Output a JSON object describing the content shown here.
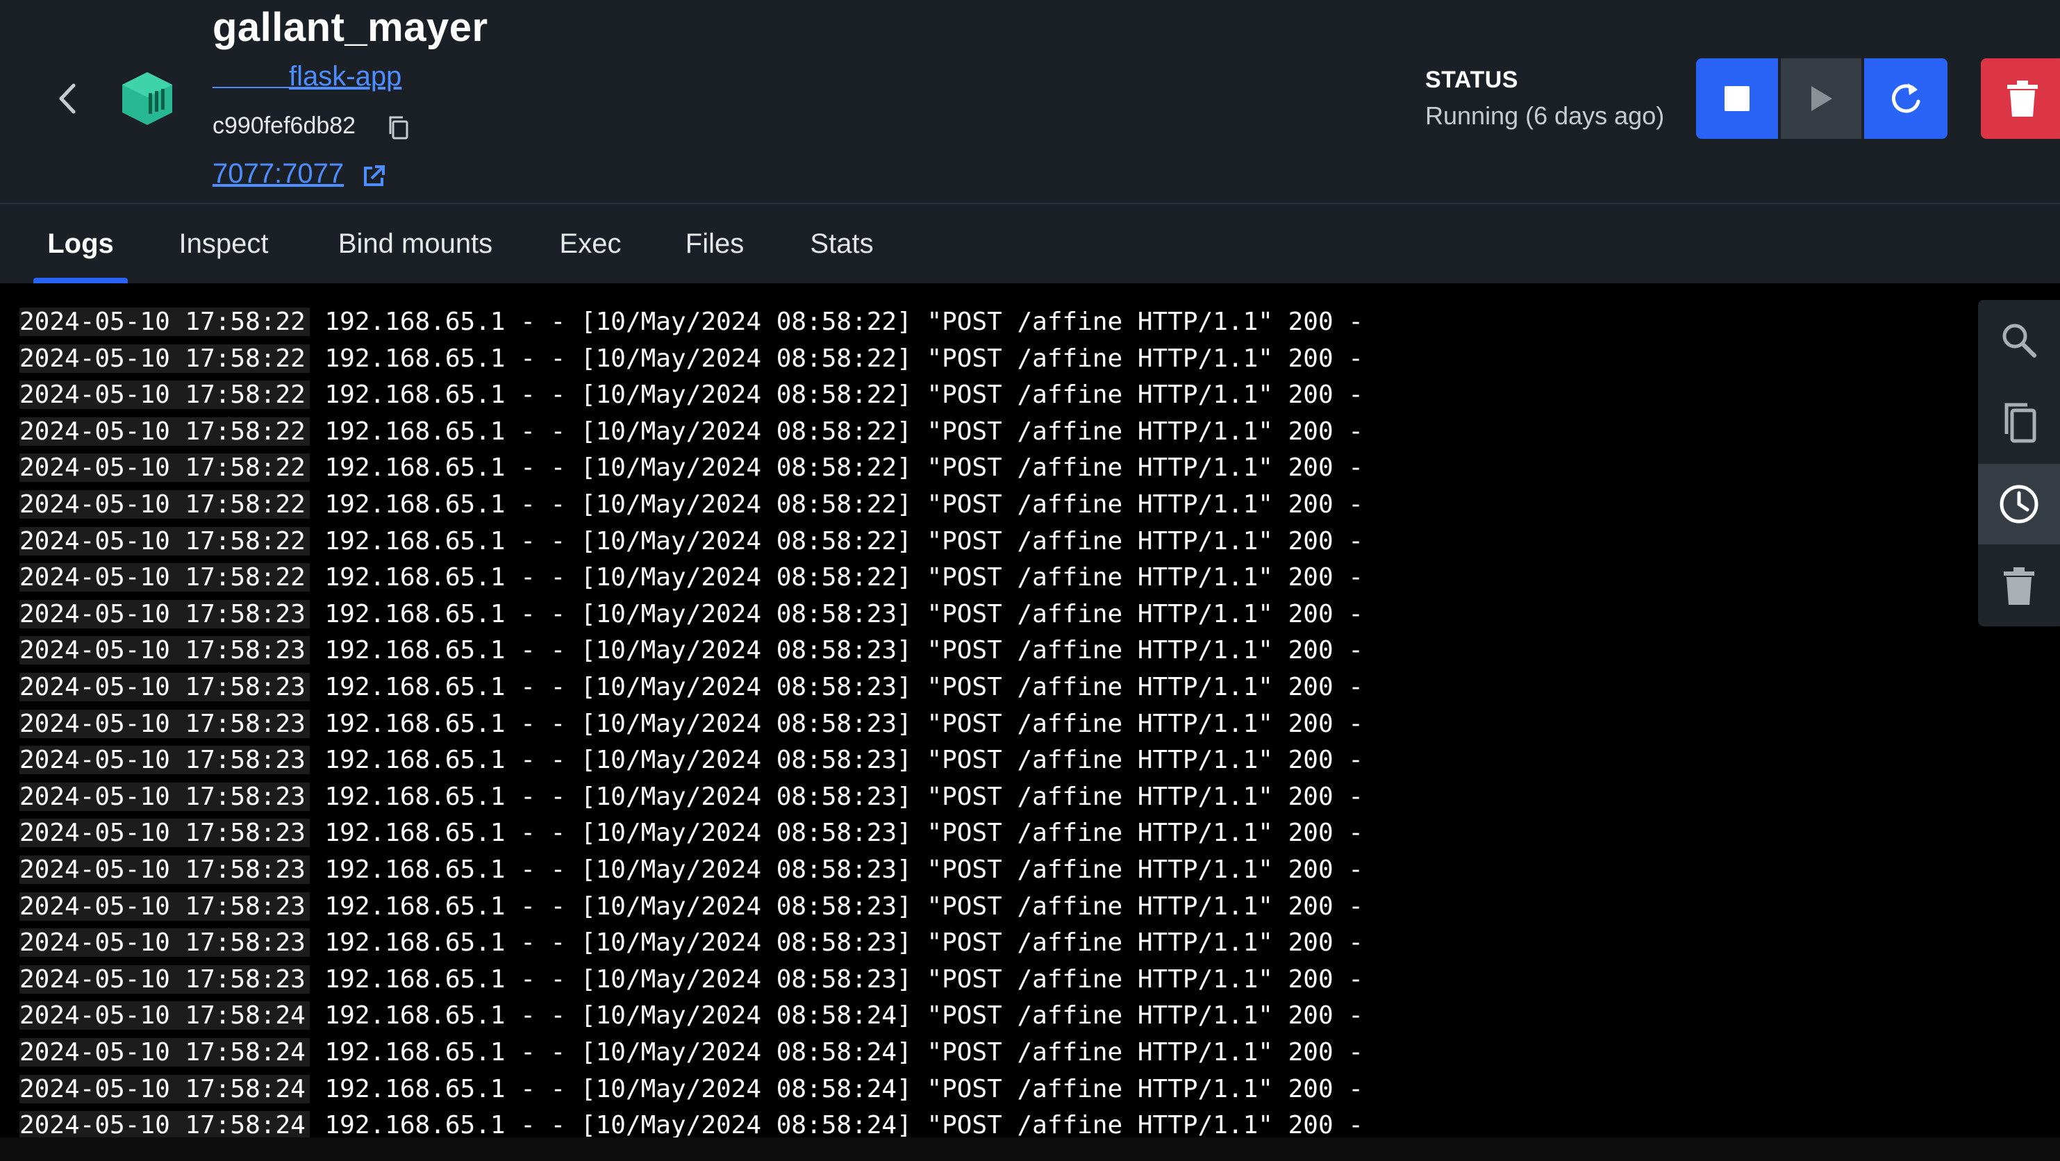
{
  "header": {
    "container_name": "gallant_mayer",
    "image_link": "flask-app",
    "container_id": "c990fef6db82",
    "port_link": "7077:7077",
    "status_label": "STATUS",
    "status_value": "Running (6 days ago)"
  },
  "colors": {
    "accent": "#2a64f6",
    "link": "#4c8dff",
    "danger": "#dc3545",
    "container_logo": "#26b991"
  },
  "icons": {
    "back": "chevron-left-icon",
    "logo": "container-icon",
    "copy": "copy-icon",
    "external": "external-link-icon",
    "stop": "stop-icon",
    "start": "play-icon",
    "restart": "restart-icon",
    "delete": "trash-icon",
    "search": "search-icon",
    "copy_logs": "copy-icon",
    "timestamps": "clock-icon",
    "clear": "trash-icon"
  },
  "tabs": [
    {
      "label": "Logs",
      "active": true
    },
    {
      "label": "Inspect"
    },
    {
      "label": "Bind mounts"
    },
    {
      "label": "Exec"
    },
    {
      "label": "Files"
    },
    {
      "label": "Stats"
    }
  ],
  "logs": [
    {
      "ts": "2024-05-10 17:58:22",
      "msg": " 192.168.65.1 - - [10/May/2024 08:58:22] \"POST /affine HTTP/1.1\" 200 -"
    },
    {
      "ts": "2024-05-10 17:58:22",
      "msg": " 192.168.65.1 - - [10/May/2024 08:58:22] \"POST /affine HTTP/1.1\" 200 -"
    },
    {
      "ts": "2024-05-10 17:58:22",
      "msg": " 192.168.65.1 - - [10/May/2024 08:58:22] \"POST /affine HTTP/1.1\" 200 -"
    },
    {
      "ts": "2024-05-10 17:58:22",
      "msg": " 192.168.65.1 - - [10/May/2024 08:58:22] \"POST /affine HTTP/1.1\" 200 -"
    },
    {
      "ts": "2024-05-10 17:58:22",
      "msg": " 192.168.65.1 - - [10/May/2024 08:58:22] \"POST /affine HTTP/1.1\" 200 -"
    },
    {
      "ts": "2024-05-10 17:58:22",
      "msg": " 192.168.65.1 - - [10/May/2024 08:58:22] \"POST /affine HTTP/1.1\" 200 -"
    },
    {
      "ts": "2024-05-10 17:58:22",
      "msg": " 192.168.65.1 - - [10/May/2024 08:58:22] \"POST /affine HTTP/1.1\" 200 -"
    },
    {
      "ts": "2024-05-10 17:58:22",
      "msg": " 192.168.65.1 - - [10/May/2024 08:58:22] \"POST /affine HTTP/1.1\" 200 -"
    },
    {
      "ts": "2024-05-10 17:58:23",
      "msg": " 192.168.65.1 - - [10/May/2024 08:58:23] \"POST /affine HTTP/1.1\" 200 -"
    },
    {
      "ts": "2024-05-10 17:58:23",
      "msg": " 192.168.65.1 - - [10/May/2024 08:58:23] \"POST /affine HTTP/1.1\" 200 -"
    },
    {
      "ts": "2024-05-10 17:58:23",
      "msg": " 192.168.65.1 - - [10/May/2024 08:58:23] \"POST /affine HTTP/1.1\" 200 -"
    },
    {
      "ts": "2024-05-10 17:58:23",
      "msg": " 192.168.65.1 - - [10/May/2024 08:58:23] \"POST /affine HTTP/1.1\" 200 -"
    },
    {
      "ts": "2024-05-10 17:58:23",
      "msg": " 192.168.65.1 - - [10/May/2024 08:58:23] \"POST /affine HTTP/1.1\" 200 -"
    },
    {
      "ts": "2024-05-10 17:58:23",
      "msg": " 192.168.65.1 - - [10/May/2024 08:58:23] \"POST /affine HTTP/1.1\" 200 -"
    },
    {
      "ts": "2024-05-10 17:58:23",
      "msg": " 192.168.65.1 - - [10/May/2024 08:58:23] \"POST /affine HTTP/1.1\" 200 -"
    },
    {
      "ts": "2024-05-10 17:58:23",
      "msg": " 192.168.65.1 - - [10/May/2024 08:58:23] \"POST /affine HTTP/1.1\" 200 -"
    },
    {
      "ts": "2024-05-10 17:58:23",
      "msg": " 192.168.65.1 - - [10/May/2024 08:58:23] \"POST /affine HTTP/1.1\" 200 -"
    },
    {
      "ts": "2024-05-10 17:58:23",
      "msg": " 192.168.65.1 - - [10/May/2024 08:58:23] \"POST /affine HTTP/1.1\" 200 -"
    },
    {
      "ts": "2024-05-10 17:58:23",
      "msg": " 192.168.65.1 - - [10/May/2024 08:58:23] \"POST /affine HTTP/1.1\" 200 -"
    },
    {
      "ts": "2024-05-10 17:58:24",
      "msg": " 192.168.65.1 - - [10/May/2024 08:58:24] \"POST /affine HTTP/1.1\" 200 -"
    },
    {
      "ts": "2024-05-10 17:58:24",
      "msg": " 192.168.65.1 - - [10/May/2024 08:58:24] \"POST /affine HTTP/1.1\" 200 -"
    },
    {
      "ts": "2024-05-10 17:58:24",
      "msg": " 192.168.65.1 - - [10/May/2024 08:58:24] \"POST /affine HTTP/1.1\" 200 -"
    },
    {
      "ts": "2024-05-10 17:58:24",
      "msg": " 192.168.65.1 - - [10/May/2024 08:58:24] \"POST /affine HTTP/1.1\" 200 -"
    }
  ]
}
